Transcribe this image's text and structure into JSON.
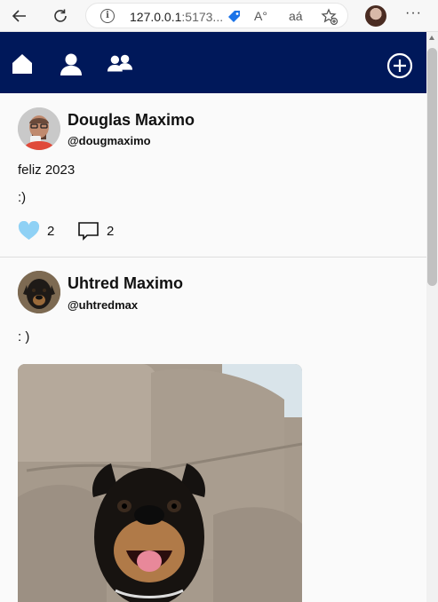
{
  "browser": {
    "url_host": "127.0.0.1",
    "url_port": ":5173...",
    "read_aloud_glyph": "A°",
    "translate_glyph": "aá",
    "more_glyph": "···"
  },
  "nav": {
    "items": [
      {
        "icon": "home-icon"
      },
      {
        "icon": "user-icon"
      },
      {
        "icon": "users-icon"
      }
    ],
    "add_icon": "plus-circle-icon",
    "background": "#00185a"
  },
  "posts": [
    {
      "author": "Douglas Maximo",
      "handle": "@dougmaximo",
      "text_lines": [
        "feliz 2023",
        ":)"
      ],
      "likes": "2",
      "comments": "2",
      "like_color": "#8fd1f5"
    },
    {
      "author": "Uhtred Maximo",
      "handle": "@uhtredmax",
      "text_lines": [
        ": )"
      ]
    }
  ]
}
